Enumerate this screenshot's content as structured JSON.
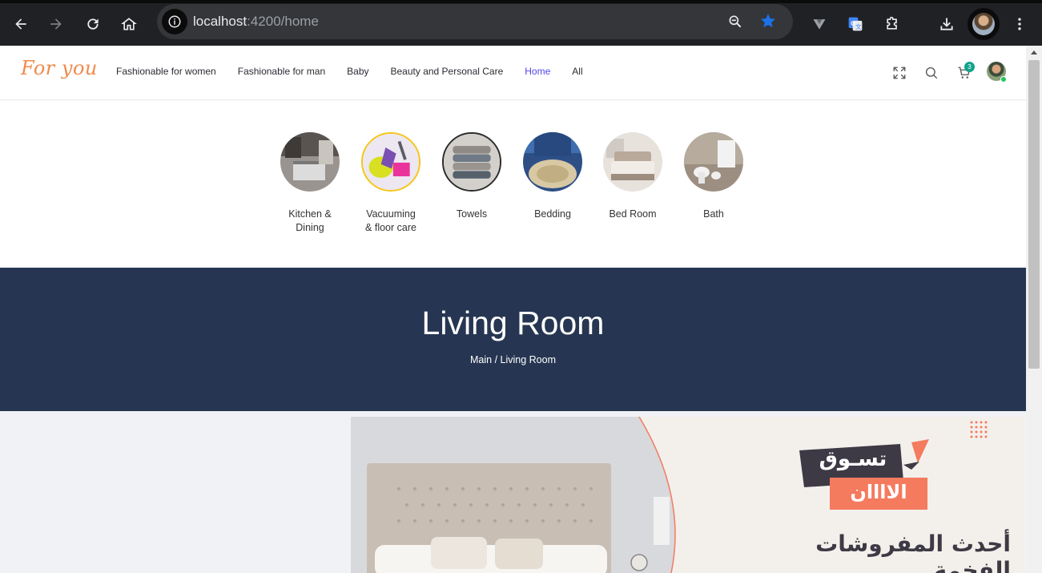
{
  "browser": {
    "url_host": "localhost",
    "url_rest": ":4200/home"
  },
  "header": {
    "logo": "For you",
    "nav": [
      {
        "label": "Fashionable for women",
        "active": false
      },
      {
        "label": "Fashionable for man",
        "active": false
      },
      {
        "label": "Baby",
        "active": false
      },
      {
        "label": "Beauty and Personal Care",
        "active": false
      },
      {
        "label": "Home",
        "active": true
      },
      {
        "label": "All",
        "active": false
      }
    ],
    "cart_count": "3",
    "active_color": "#4f46e5",
    "logo_color": "#f08a4b"
  },
  "categories": [
    {
      "line1": "Kitchen &",
      "line2": "Dining"
    },
    {
      "line1": "Vacuuming",
      "line2": "& floor care"
    },
    {
      "line1": "Towels",
      "line2": ""
    },
    {
      "line1": "Bedding",
      "line2": ""
    },
    {
      "line1": "Bed Room",
      "line2": ""
    },
    {
      "line1": "Bath",
      "line2": ""
    }
  ],
  "banner": {
    "title": "Living Room",
    "breadcrumb": "Main / Living Room",
    "background": "#263652"
  },
  "promo": {
    "shop_now_line1": "تسـوق",
    "shop_now_line2": "الاااان",
    "tagline": "أحدث المفروشات الفخمة",
    "accent": "#f47b5e"
  }
}
